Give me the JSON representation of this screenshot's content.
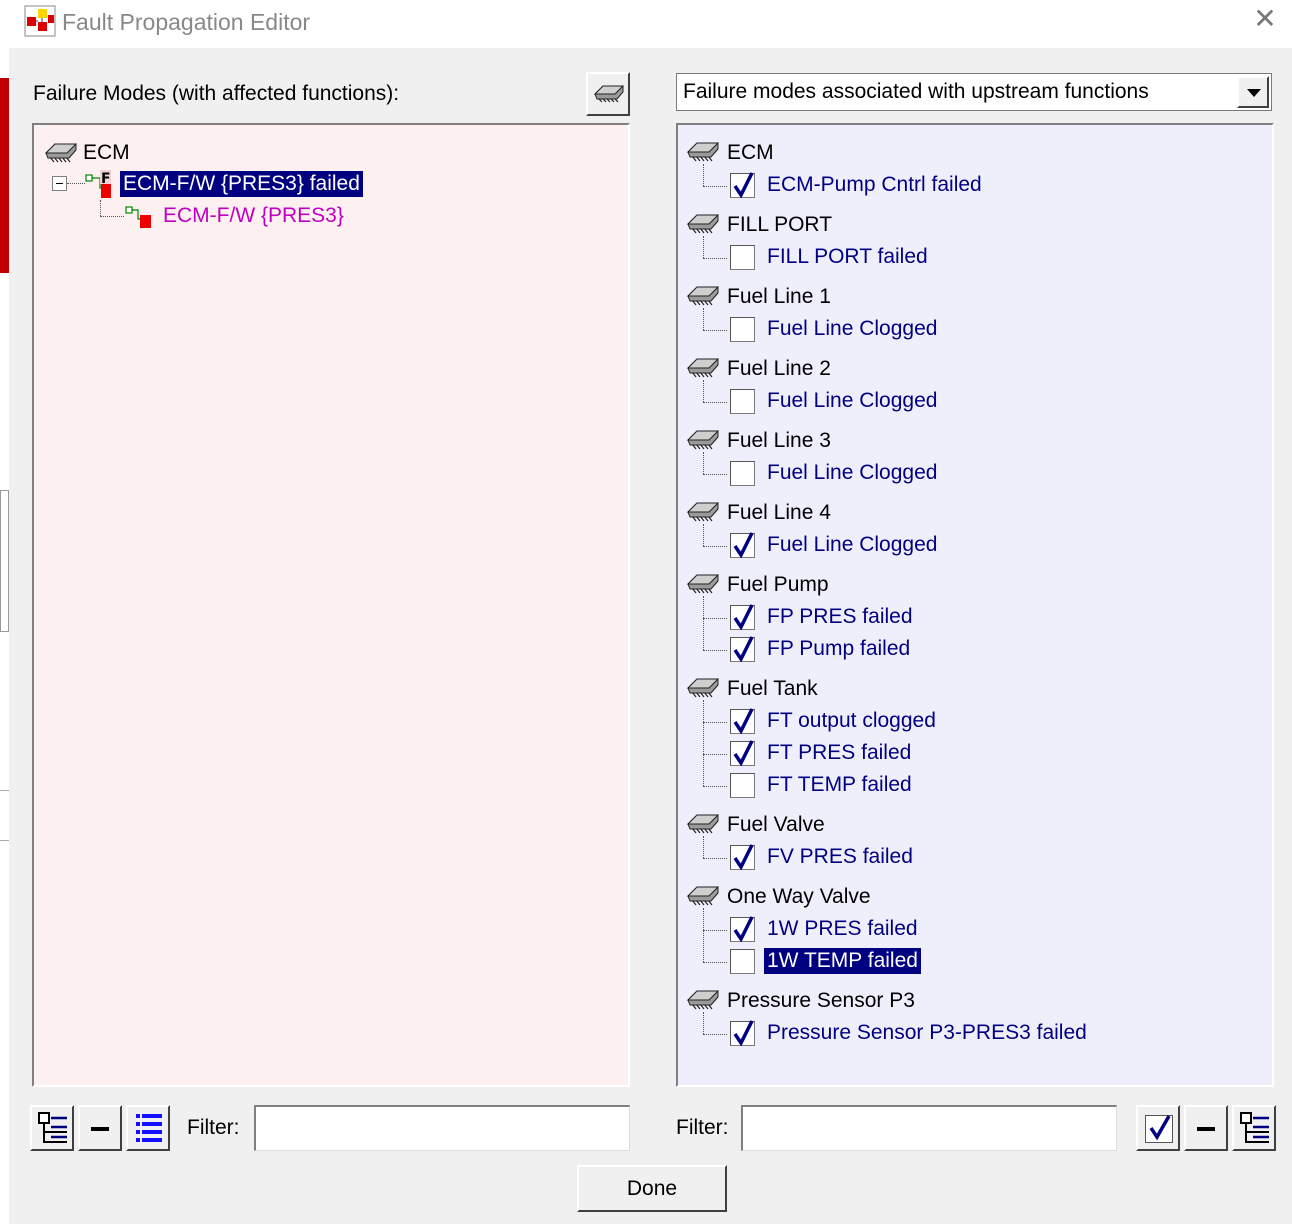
{
  "window": {
    "title": "Fault Propagation Editor",
    "close_symbol": "✕"
  },
  "left": {
    "header": "Failure Modes (with affected functions):",
    "tree": {
      "root_label": "ECM",
      "failure_label": "ECM-F/W {PRES3} failed",
      "function_label": "ECM-F/W {PRES3}"
    },
    "filter_label": "Filter:",
    "filter_value": ""
  },
  "right": {
    "dropdown_value": "Failure modes associated with upstream functions",
    "groups": [
      {
        "component": "ECM",
        "modes": [
          {
            "label": "ECM-Pump Cntrl failed",
            "checked": true
          }
        ]
      },
      {
        "component": "FILL PORT",
        "modes": [
          {
            "label": "FILL PORT failed",
            "checked": false
          }
        ]
      },
      {
        "component": "Fuel Line 1",
        "modes": [
          {
            "label": "Fuel Line Clogged",
            "checked": false
          }
        ]
      },
      {
        "component": "Fuel Line 2",
        "modes": [
          {
            "label": "Fuel Line Clogged",
            "checked": false
          }
        ]
      },
      {
        "component": "Fuel Line 3",
        "modes": [
          {
            "label": "Fuel Line Clogged",
            "checked": false
          }
        ]
      },
      {
        "component": "Fuel Line 4",
        "modes": [
          {
            "label": "Fuel Line Clogged",
            "checked": true
          }
        ]
      },
      {
        "component": "Fuel Pump",
        "modes": [
          {
            "label": "FP PRES failed",
            "checked": true
          },
          {
            "label": "FP Pump failed",
            "checked": true
          }
        ]
      },
      {
        "component": "Fuel Tank",
        "modes": [
          {
            "label": "FT output clogged",
            "checked": true
          },
          {
            "label": "FT PRES failed",
            "checked": true
          },
          {
            "label": "FT TEMP failed",
            "checked": false
          }
        ]
      },
      {
        "component": "Fuel Valve",
        "modes": [
          {
            "label": "FV PRES failed",
            "checked": true
          }
        ]
      },
      {
        "component": "One Way Valve",
        "modes": [
          {
            "label": "1W PRES failed",
            "checked": true
          },
          {
            "label": "1W TEMP failed",
            "checked": false,
            "selected": true
          }
        ]
      },
      {
        "component": "Pressure Sensor P3",
        "modes": [
          {
            "label": "Pressure Sensor P3-PRES3 failed",
            "checked": true
          }
        ]
      }
    ],
    "filter_label": "Filter:",
    "filter_value": ""
  },
  "footer": {
    "done_label": "Done"
  },
  "colors": {
    "left_panel_bg": "#fdf0f0",
    "right_panel_bg": "#efeffc",
    "selection_bg": "#000080",
    "mode_text": "#000080",
    "function_text": "#c000c0"
  }
}
